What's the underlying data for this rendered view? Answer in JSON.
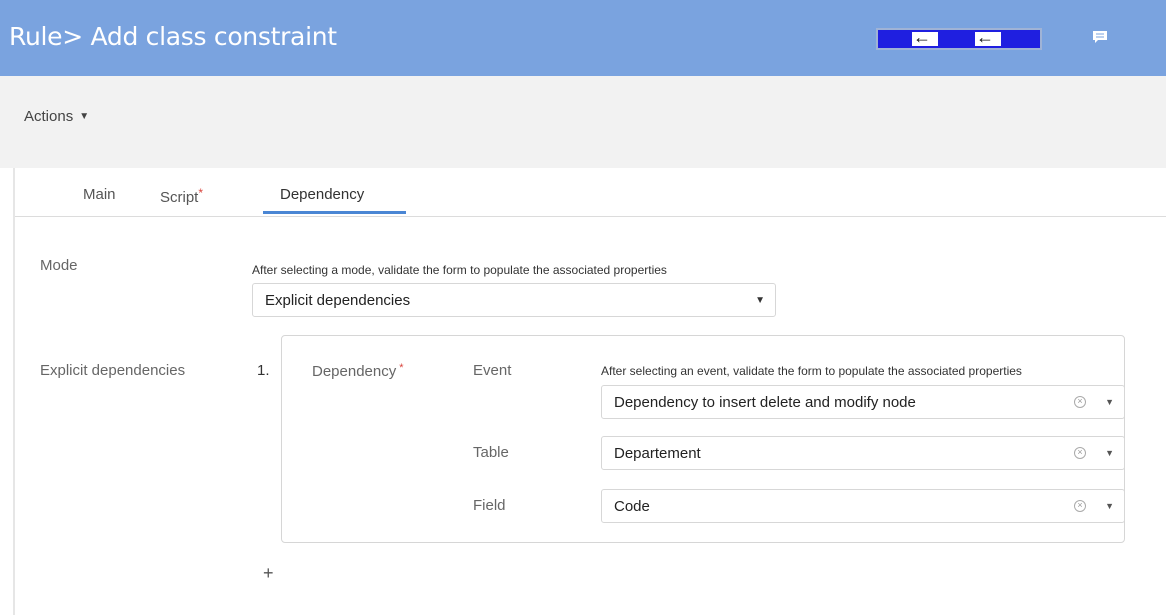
{
  "header": {
    "title": "Rule> Add class constraint",
    "chat_icon": "chat-bubble-icon",
    "flow_arrows": [
      "←",
      "←"
    ]
  },
  "toolbar": {
    "actions_label": "Actions",
    "actions_caret": "▼"
  },
  "tabs": [
    {
      "label": "Main",
      "required": false
    },
    {
      "label": "Script",
      "required": true
    },
    {
      "label": "Dependency",
      "required": false,
      "active": true
    }
  ],
  "required_marker": "*",
  "mode": {
    "label": "Mode",
    "hint": "After selecting a mode, validate the form to populate the associated properties",
    "value": "Explicit dependencies",
    "arrow": "▼"
  },
  "explicit": {
    "label": "Explicit dependencies",
    "index": "1.",
    "dependency_label": "Dependency",
    "event": {
      "label": "Event",
      "hint": "After selecting an event, validate the form to populate the associated properties",
      "value": "Dependency to insert delete and modify node"
    },
    "table": {
      "label": "Table",
      "value": "Departement"
    },
    "field": {
      "label": "Field",
      "value": "Code"
    },
    "add_label": "+"
  },
  "colors": {
    "header_bg": "#7aa3df",
    "tab_active": "#4a86d4",
    "required": "#d9443c",
    "flow_box": "#1f1fe0"
  }
}
